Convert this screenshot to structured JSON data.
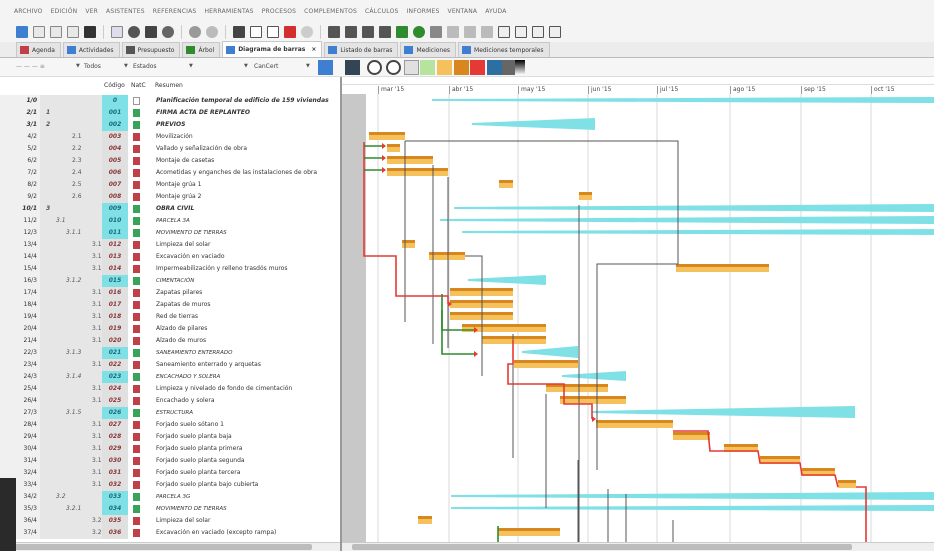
{
  "menu": [
    "ARCHIVO",
    "EDICIÓN",
    "VER",
    "ASISTENTES",
    "REFERENCIAS",
    "HERRAMIENTAS",
    "PROCESOS",
    "COMPLEMENTOS",
    "CÁLCULOS",
    "INFORMES",
    "VENTANA",
    "AYUDA"
  ],
  "tabs": [
    {
      "label": "Agenda",
      "active": false
    },
    {
      "label": "Actividades",
      "active": false
    },
    {
      "label": "Presupuesto",
      "active": false
    },
    {
      "label": "Árbol",
      "active": false
    },
    {
      "label": "Diagrama de barras",
      "active": true,
      "close": "×"
    },
    {
      "label": "Listado de barras",
      "active": false
    },
    {
      "label": "Mediciones",
      "active": false
    },
    {
      "label": "Mediciones temporales",
      "active": false
    }
  ],
  "filters": {
    "todos": "Todos",
    "estados": "Estados",
    "cancert": "CanCert"
  },
  "columns": {
    "codigo": "Código",
    "natc": "NatC",
    "resumen": "Resumen"
  },
  "months": [
    "mar '15",
    "abr '15",
    "may '15",
    "jun '15",
    "jul '15",
    "ago '15",
    "sep '15",
    "oct '15"
  ],
  "colors": {
    "bar": "#f5c15c",
    "bar_top": "#d8861e",
    "summary": "#7fe0e6",
    "critical": "#e53935",
    "link": "#555555",
    "start_link": "#2e8b2e",
    "nat_chapter": "#3aa35a",
    "nat_task": "#c0404a"
  },
  "rows": [
    {
      "num": "1/0",
      "bold": true,
      "wbs": "",
      "code": "0",
      "desc": "Planificación temporal de edificio de 159 viviendas",
      "kind": "root"
    },
    {
      "num": "2/1",
      "bold": true,
      "wbs": "1",
      "code": "001",
      "desc": "FIRMA ACTA DE REPLANTEO",
      "kind": "chapter"
    },
    {
      "num": "3/1",
      "bold": true,
      "wbs": "2",
      "code": "002",
      "desc": "PREVIOS",
      "kind": "chapter"
    },
    {
      "num": "4/2",
      "wbs": "2.1",
      "code": "003",
      "desc": "Movilización",
      "kind": "task"
    },
    {
      "num": "5/2",
      "wbs": "2.2",
      "code": "004",
      "desc": "Vallado y señalización de obra",
      "kind": "task"
    },
    {
      "num": "6/2",
      "wbs": "2.3",
      "code": "005",
      "desc": "Montaje de casetas",
      "kind": "task"
    },
    {
      "num": "7/2",
      "wbs": "2.4",
      "code": "006",
      "desc": "Acometidas y enganches de las instalaciones de obra",
      "kind": "task"
    },
    {
      "num": "8/2",
      "wbs": "2.5",
      "code": "007",
      "desc": "Montaje grúa 1",
      "kind": "task"
    },
    {
      "num": "9/2",
      "wbs": "2.6",
      "code": "008",
      "desc": "Montaje grúa 2",
      "kind": "task"
    },
    {
      "num": "10/1",
      "bold": true,
      "wbs": "3",
      "code": "009",
      "desc": "OBRA CIVIL",
      "kind": "chapter"
    },
    {
      "num": "11/2",
      "wbs": "3.1",
      "code": "010",
      "desc": "PARCELA 3A",
      "kind": "sub"
    },
    {
      "num": "12/3",
      "wbs": "3.1.1",
      "code": "011",
      "desc": "MOVIMIENTO DE TIERRAS",
      "kind": "sub"
    },
    {
      "num": "13/4",
      "wbs": "3.1.1.1",
      "code": "012",
      "desc": "Limpieza del solar",
      "kind": "task"
    },
    {
      "num": "14/4",
      "wbs": "3.1.1.2",
      "code": "013",
      "desc": "Excavación en vaciado",
      "kind": "task"
    },
    {
      "num": "15/4",
      "wbs": "3.1.1.3",
      "code": "014",
      "desc": "Impermeabilización y relleno trasdós muros",
      "kind": "task"
    },
    {
      "num": "16/3",
      "wbs": "3.1.2",
      "code": "015",
      "desc": "CIMENTACIÓN",
      "kind": "sub"
    },
    {
      "num": "17/4",
      "wbs": "3.1.2.1",
      "code": "016",
      "desc": "Zapatas pilares",
      "kind": "task"
    },
    {
      "num": "18/4",
      "wbs": "3.1.2.2",
      "code": "017",
      "desc": "Zapatas de muros",
      "kind": "task"
    },
    {
      "num": "19/4",
      "wbs": "3.1.2.3",
      "code": "018",
      "desc": "Red de tierras",
      "kind": "task"
    },
    {
      "num": "20/4",
      "wbs": "3.1.2.4",
      "code": "019",
      "desc": "Alzado de pilares",
      "kind": "task"
    },
    {
      "num": "21/4",
      "wbs": "3.1.2.5",
      "code": "020",
      "desc": "Alzado de muros",
      "kind": "task"
    },
    {
      "num": "22/3",
      "wbs": "3.1.3",
      "code": "021",
      "desc": "SANEAMIENTO ENTERRADO",
      "kind": "sub"
    },
    {
      "num": "23/4",
      "wbs": "3.1.3.1",
      "code": "022",
      "desc": "Saneamiento enterrado y arquetas",
      "kind": "task"
    },
    {
      "num": "24/3",
      "wbs": "3.1.4",
      "code": "023",
      "desc": "ENCACHADO Y SOLERA",
      "kind": "sub"
    },
    {
      "num": "25/4",
      "wbs": "3.1.4.1",
      "code": "024",
      "desc": "Limpieza y nivelado de fondo de cimentación",
      "kind": "task"
    },
    {
      "num": "26/4",
      "wbs": "3.1.4.2",
      "code": "025",
      "desc": "Encachado y solera",
      "kind": "task"
    },
    {
      "num": "27/3",
      "wbs": "3.1.5",
      "code": "026",
      "desc": "ESTRUCTURA",
      "kind": "sub"
    },
    {
      "num": "28/4",
      "wbs": "3.1.5.1",
      "code": "027",
      "desc": "Forjado suelo sótano 1",
      "kind": "task"
    },
    {
      "num": "29/4",
      "wbs": "3.1.5.2",
      "code": "028",
      "desc": "Forjado suelo planta baja",
      "kind": "task"
    },
    {
      "num": "30/4",
      "wbs": "3.1.5.3",
      "code": "029",
      "desc": "Forjado suelo planta primera",
      "kind": "task"
    },
    {
      "num": "31/4",
      "wbs": "3.1.5.4",
      "code": "030",
      "desc": "Forjado suelo planta segunda",
      "kind": "task"
    },
    {
      "num": "32/4",
      "wbs": "3.1.5.5",
      "code": "031",
      "desc": "Forjado suelo planta tercera",
      "kind": "task"
    },
    {
      "num": "33/4",
      "wbs": "3.1.5.6",
      "code": "032",
      "desc": "Forjado suelo planta bajo cubierta",
      "kind": "task"
    },
    {
      "num": "34/2",
      "wbs": "3.2",
      "code": "033",
      "desc": "PARCELA 3G",
      "kind": "sub"
    },
    {
      "num": "35/3",
      "wbs": "3.2.1",
      "code": "034",
      "desc": "MOVIMIENTO DE TIERRAS",
      "kind": "sub"
    },
    {
      "num": "36/4",
      "wbs": "3.2.1.1",
      "code": "035",
      "desc": "Limpieza del solar",
      "kind": "task"
    },
    {
      "num": "37/4",
      "wbs": "3.2.1.2",
      "code": "036",
      "desc": "Excavación en vaciado (excepto rampa)",
      "kind": "task"
    }
  ]
}
